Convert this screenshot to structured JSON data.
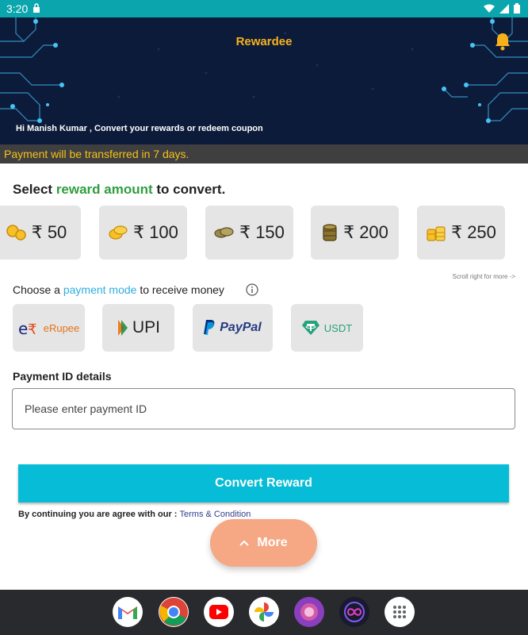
{
  "status_bar": {
    "time": "3:20"
  },
  "header": {
    "title": "Rewardee",
    "greeting": "Hi Manish Kumar , Convert your rewards or redeem coupon"
  },
  "notice": "Payment will be transferred in 7 days.",
  "reward_section": {
    "title_prefix": "Select ",
    "title_highlight": "reward amount",
    "title_suffix": " to convert.",
    "amounts": [
      {
        "label": "₹ 50",
        "icon": "coins-icon"
      },
      {
        "label": "₹ 100",
        "icon": "coins-icon"
      },
      {
        "label": "₹ 150",
        "icon": "coins-icon"
      },
      {
        "label": "₹ 200",
        "icon": "coins-icon"
      },
      {
        "label": "₹ 250",
        "icon": "coins-icon"
      }
    ],
    "scroll_hint": "Scroll right for more ->"
  },
  "payment_section": {
    "title_prefix": "Choose a ",
    "title_highlight": "payment mode",
    "title_suffix": " to receive money",
    "modes": [
      {
        "label": "eRupee",
        "icon": "erupee-icon"
      },
      {
        "label": "UPI",
        "icon": "upi-icon"
      },
      {
        "label": "PayPal",
        "icon": "paypal-icon"
      },
      {
        "label": "USDT",
        "icon": "tether-icon"
      }
    ]
  },
  "payment_id": {
    "label": "Payment ID details",
    "placeholder": "Please enter payment ID"
  },
  "convert_button": "Convert Reward",
  "terms": {
    "prefix": "By continuing you are agree with our : ",
    "link": "Terms & Condition"
  },
  "more_button": "More",
  "colors": {
    "accent": "#07bcd6",
    "more": "#f6a784",
    "highlight_green": "#2e9e3d",
    "highlight_blue": "#2eaee0",
    "title_gold": "#f7b21b"
  }
}
